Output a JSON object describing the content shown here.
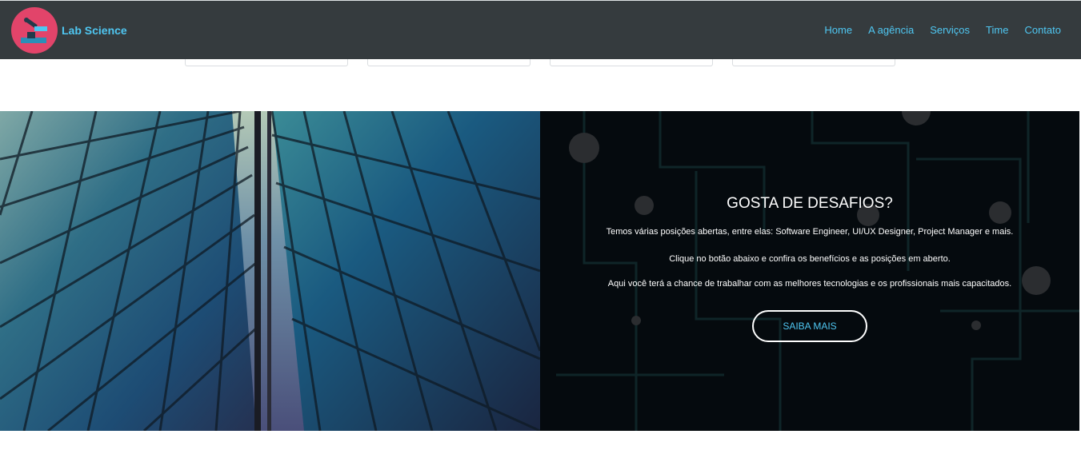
{
  "brand": {
    "name": "Lab Science",
    "logo_icon": "microscope-icon",
    "logo_color": "#e2446a"
  },
  "nav": {
    "items": [
      {
        "label": "Home"
      },
      {
        "label": "A agência"
      },
      {
        "label": "Serviços"
      },
      {
        "label": "Time"
      },
      {
        "label": "Contato"
      }
    ]
  },
  "cta": {
    "title": "GOSTA DE DESAFIOS?",
    "lines": [
      "Temos várias posições abertas, entre elas: Software Engineer, UI/UX Designer, Project Manager e mais.",
      "Clique no botão abaixo e confira os benefícios e as posições em aberto.",
      "Aqui você terá a chance de trabalhar com as melhores tecnologias e os profissionais mais capacitados."
    ],
    "button_label": "SAIBA MAIS"
  },
  "colors": {
    "navbar": "#353b3e",
    "accent": "#4fc7f2",
    "panel": "#050a0e"
  }
}
